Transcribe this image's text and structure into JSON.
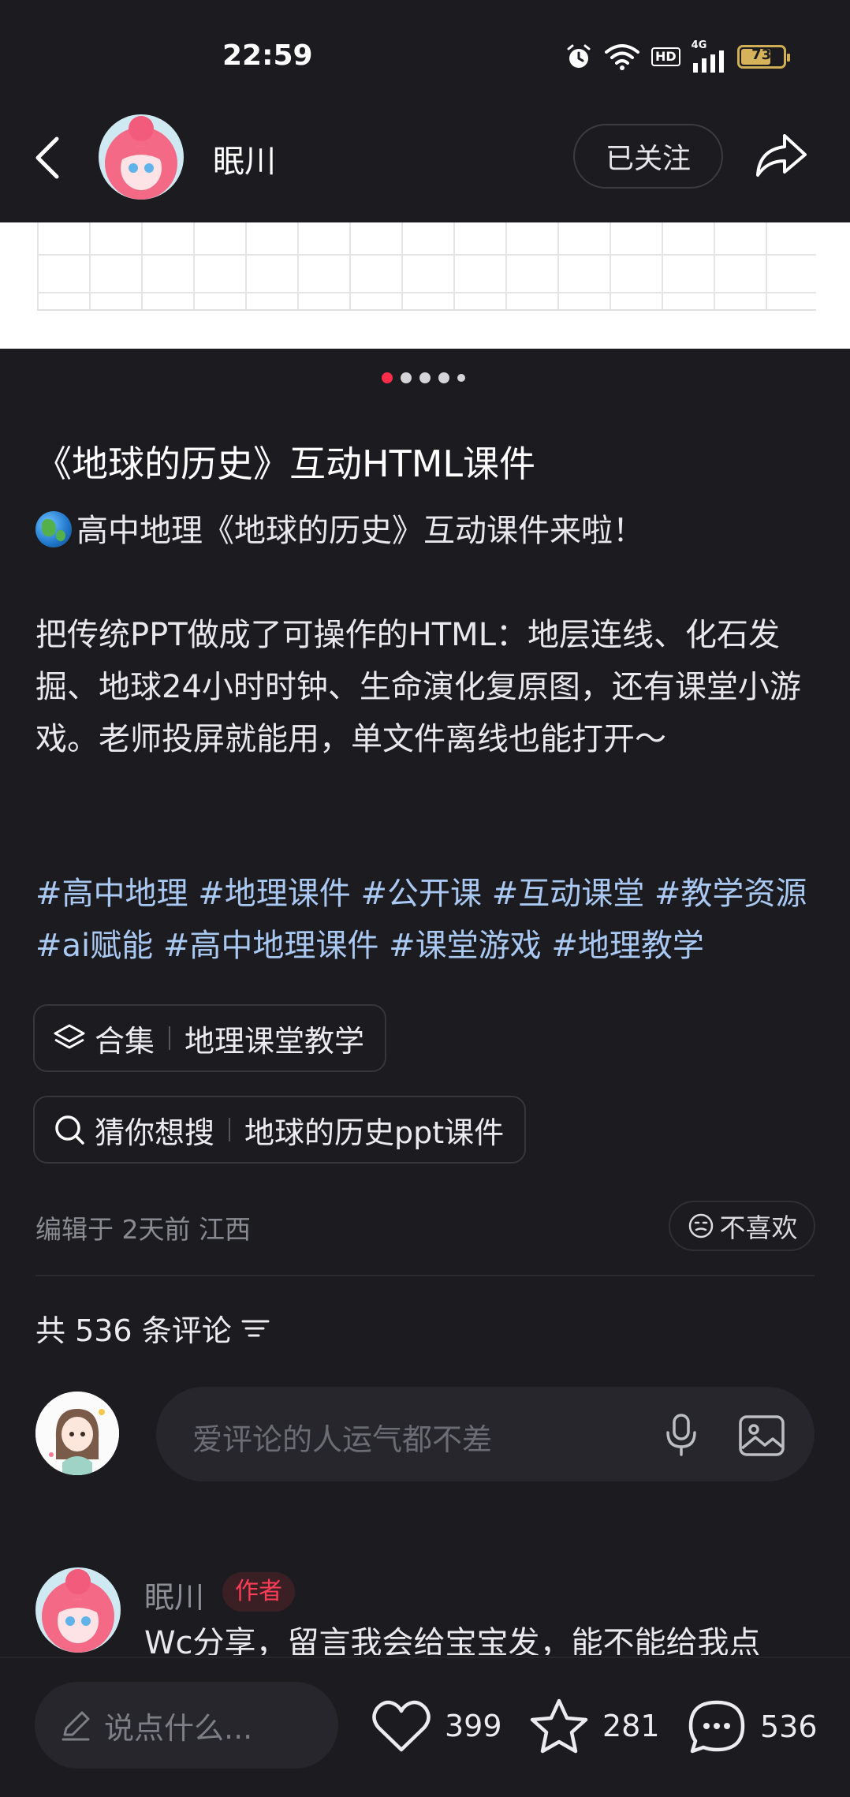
{
  "status_bar": {
    "time": "22:59",
    "network": "4G",
    "hd": "HD",
    "battery": "73",
    "battery_level": 0.73
  },
  "header": {
    "author_name": "眠川",
    "follow_label": "已关注"
  },
  "gallery": {
    "total_images": 5,
    "current_index": 0
  },
  "post": {
    "title": "《地球的历史》互动HTML课件",
    "intro": "高中地理《地球的历史》互动课件来啦！",
    "body": "把传统PPT做成了可操作的HTML：地层连线、化石发掘、地球24小时时钟、生命演化复原图，还有课堂小游戏。老师投屏就能用，单文件离线也能打开～",
    "hashtags": "#高中地理 #地理课件 #公开课 #互动课堂 #教学资源#ai赋能 #高中地理课件 #课堂游戏 #地理教学"
  },
  "collection": {
    "label": "合集",
    "value": "地理课堂教学"
  },
  "guess_search": {
    "label": "猜你想搜",
    "value": "地球的历史ppt课件"
  },
  "meta": {
    "edited": "编辑于 2天前 江西",
    "dislike_label": "不喜欢"
  },
  "comments": {
    "count_label": "共 536 条评论",
    "input_placeholder": "爱评论的人运气都不差",
    "items": [
      {
        "name": "眠川",
        "tag": "作者",
        "text": "Wc分享，留言我会给宝宝发，能不能给我点"
      }
    ]
  },
  "bottom_bar": {
    "say_placeholder": "说点什么...",
    "likes": "399",
    "favorites": "281",
    "comments": "536"
  },
  "colors": {
    "background": "#1b1b20",
    "accent_red": "#ff2d48",
    "hashtag": "#a9c8f2"
  }
}
